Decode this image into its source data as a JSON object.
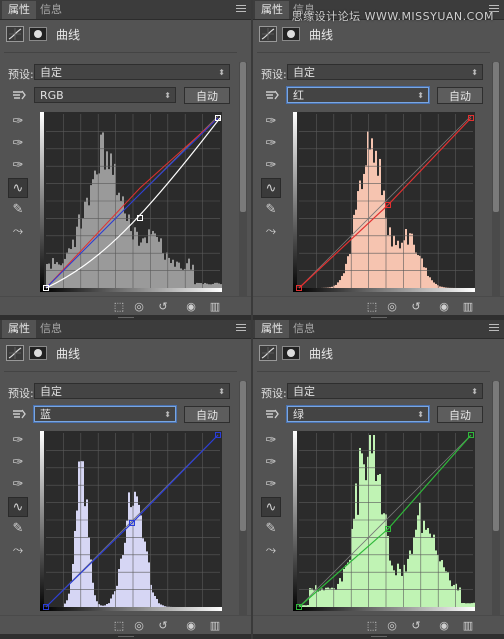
{
  "watermark": "思缘设计论坛 WWW.MISSYUAN.COM",
  "panels": [
    {
      "tabs": [
        "属性",
        "信息"
      ],
      "title": "曲线",
      "preset_label": "预设:",
      "preset_value": "自定",
      "channel_value": "RGB",
      "channel_focused": false,
      "auto_label": "自动",
      "curve_color": "#ffffff",
      "hist_color": "#9a9a9a",
      "has_rgb_overlay": true,
      "show_watermark": false
    },
    {
      "tabs": [
        "属性",
        "信息"
      ],
      "title": "曲线",
      "preset_label": "预设:",
      "preset_value": "自定",
      "channel_value": "红",
      "channel_focused": true,
      "auto_label": "自动",
      "curve_color": "#e23030",
      "hist_color": "#f6c4b0",
      "has_rgb_overlay": false,
      "show_watermark": true
    },
    {
      "tabs": [
        "属性",
        "信息"
      ],
      "title": "曲线",
      "preset_label": "预设:",
      "preset_value": "自定",
      "channel_value": "蓝",
      "channel_focused": true,
      "auto_label": "自动",
      "curve_color": "#2a3cd8",
      "hist_color": "#d6d6f4",
      "has_rgb_overlay": false,
      "show_watermark": false
    },
    {
      "tabs": [
        "属性",
        "信息"
      ],
      "title": "曲线",
      "preset_label": "预设:",
      "preset_value": "自定",
      "channel_value": "绿",
      "channel_focused": true,
      "auto_label": "自动",
      "curve_color": "#2fb83a",
      "hist_color": "#c0f3b4",
      "has_rgb_overlay": false,
      "show_watermark": false
    }
  ],
  "tools": [
    "adjust-hand-icon",
    "eyedropper-black-icon",
    "eyedropper-gray-icon",
    "eyedropper-white-icon",
    "curve-point-icon",
    "pencil-draw-icon",
    "smooth-icon"
  ],
  "footer_icons": [
    "clip-to-layer-icon",
    "view-previous-icon",
    "reset-icon",
    "visibility-eye-icon",
    "trash-icon"
  ]
}
